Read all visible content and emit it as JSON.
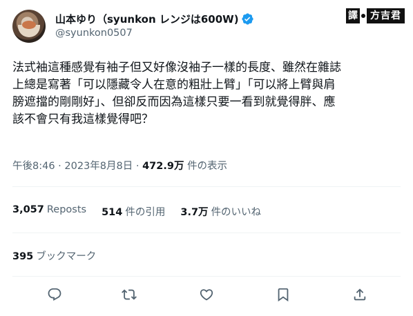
{
  "author": {
    "display_name": "山本ゆり（syunkon レンジは600W)",
    "handle": "@syunkon0507",
    "verified_icon": "verified-badge-icon"
  },
  "watermark": {
    "prefix": "譯",
    "name": "方吉君"
  },
  "tweet": {
    "lines": [
      "法式袖這種感覺有袖子但又好像沒袖子一樣的長度、雖然在雜誌",
      "上總是寫著「可以隱藏令人在意的粗壯上臂」「可以將上臂與肩",
      "膀遮擋的剛剛好」、但卻反而因為這樣只要一看到就覺得胖、應",
      "該不會只有我這樣覺得吧？"
    ]
  },
  "meta": {
    "time": "午後8:46",
    "separator": " · ",
    "date": "2023年8月8日",
    "views_count": "472.9万",
    "views_label": "件の表示"
  },
  "stats": {
    "reposts_count": "3,057",
    "reposts_label": "Reposts",
    "quotes_count": "514",
    "quotes_label": "件の引用",
    "likes_count": "3.7万",
    "likes_label": "件のいいね"
  },
  "bookmarks": {
    "count": "395",
    "label": "ブックマーク"
  },
  "actions": [
    "reply-icon",
    "retweet-icon",
    "like-icon",
    "bookmark-icon",
    "share-icon"
  ],
  "colors": {
    "text": "#0f1419",
    "secondary": "#536471",
    "verified": "#1d9bf0",
    "divider": "#eff3f4"
  }
}
